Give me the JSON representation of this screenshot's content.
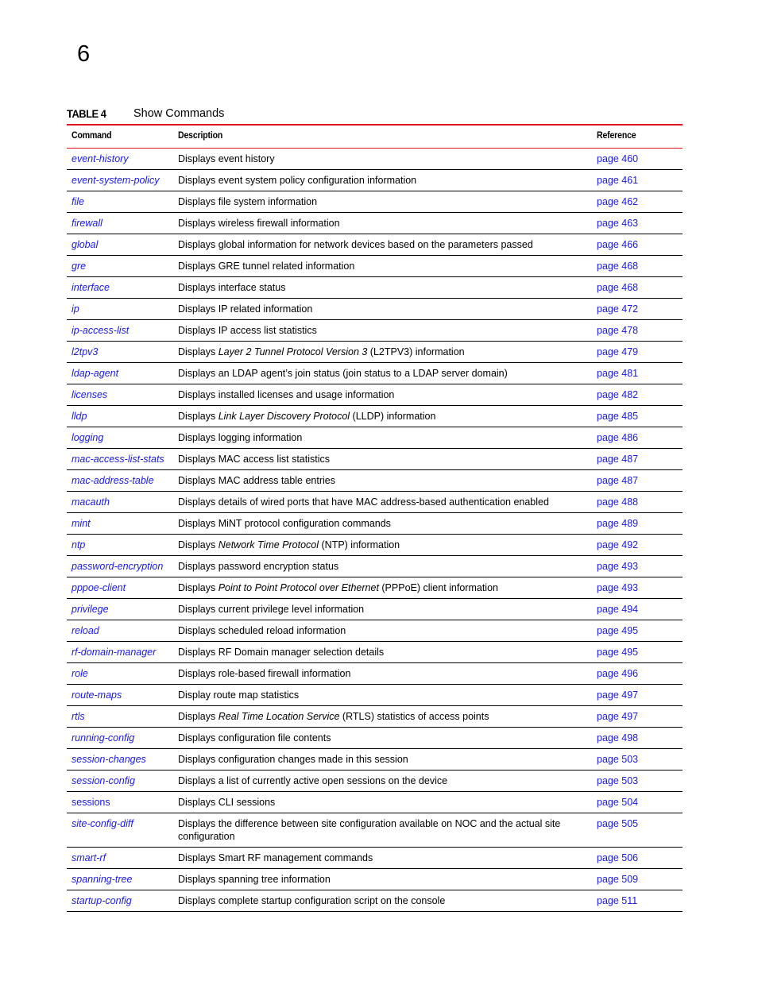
{
  "chapter_number": "6",
  "table": {
    "label": "TABLE 4",
    "title": "Show Commands",
    "headers": [
      "Command",
      "Description",
      "Reference"
    ],
    "rows": [
      {
        "command": "event-history",
        "desc": [
          {
            "t": "Displays event history"
          }
        ],
        "ref": "page 460"
      },
      {
        "command": "event-system-policy",
        "desc": [
          {
            "t": "Displays event system policy configuration information"
          }
        ],
        "ref": "page 461"
      },
      {
        "command": "file",
        "desc": [
          {
            "t": "Displays file system information"
          }
        ],
        "ref": "page 462"
      },
      {
        "command": "firewall",
        "desc": [
          {
            "t": "Displays wireless firewall information"
          }
        ],
        "ref": "page 463"
      },
      {
        "command": "global",
        "desc": [
          {
            "t": "Displays global information for network devices based on the parameters passed"
          }
        ],
        "ref": "page 466"
      },
      {
        "command": "gre",
        "desc": [
          {
            "t": "Displays GRE tunnel related information"
          }
        ],
        "ref": "page 468"
      },
      {
        "command": "interface",
        "desc": [
          {
            "t": "Displays interface status"
          }
        ],
        "ref": "page 468"
      },
      {
        "command": "ip",
        "desc": [
          {
            "t": "Displays IP related information"
          }
        ],
        "ref": "page 472"
      },
      {
        "command": "ip-access-list",
        "desc": [
          {
            "t": "Displays IP access list statistics"
          }
        ],
        "ref": "page 478"
      },
      {
        "command": "l2tpv3",
        "desc": [
          {
            "t": "Displays "
          },
          {
            "t": "Layer 2 Tunnel Protocol Version 3",
            "i": true
          },
          {
            "t": " (L2TPV3) information"
          }
        ],
        "ref": "page 479"
      },
      {
        "command": "ldap-agent",
        "desc": [
          {
            "t": "Displays an LDAP agent’s join status (join status to a LDAP server domain)"
          }
        ],
        "ref": "page 481"
      },
      {
        "command": "licenses",
        "desc": [
          {
            "t": "Displays installed licenses and usage information"
          }
        ],
        "ref": "page 482"
      },
      {
        "command": "lldp",
        "desc": [
          {
            "t": "Displays "
          },
          {
            "t": "Link Layer Discovery Protocol",
            "i": true
          },
          {
            "t": " (LLDP) information"
          }
        ],
        "ref": "page 485"
      },
      {
        "command": "logging",
        "desc": [
          {
            "t": "Displays logging information"
          }
        ],
        "ref": "page 486"
      },
      {
        "command": "mac-access-list-stats",
        "desc": [
          {
            "t": "Displays MAC access list statistics"
          }
        ],
        "ref": "page 487"
      },
      {
        "command": "mac-address-table",
        "desc": [
          {
            "t": "Displays MAC address table entries"
          }
        ],
        "ref": "page 487"
      },
      {
        "command": "macauth",
        "desc": [
          {
            "t": "Displays details of wired ports that have MAC address-based authentication enabled"
          }
        ],
        "ref": "page 488"
      },
      {
        "command": "mint",
        "desc": [
          {
            "t": "Displays MiNT protocol configuration commands"
          }
        ],
        "ref": "page 489"
      },
      {
        "command": "ntp",
        "desc": [
          {
            "t": "Displays "
          },
          {
            "t": "Network Time Protocol",
            "i": true
          },
          {
            "t": " (NTP) information"
          }
        ],
        "ref": "page 492"
      },
      {
        "command": "password-encryption",
        "desc": [
          {
            "t": "Displays password encryption status"
          }
        ],
        "ref": "page 493"
      },
      {
        "command": "pppoe-client",
        "desc": [
          {
            "t": "Displays "
          },
          {
            "t": "Point to Point Protocol over Ethernet",
            "i": true
          },
          {
            "t": " (PPPoE) client information"
          }
        ],
        "ref": "page 493"
      },
      {
        "command": "privilege",
        "desc": [
          {
            "t": "Displays current privilege level information"
          }
        ],
        "ref": "page 494"
      },
      {
        "command": "reload",
        "desc": [
          {
            "t": "Displays scheduled reload information"
          }
        ],
        "ref": "page 495"
      },
      {
        "command": "rf-domain-manager",
        "desc": [
          {
            "t": "Displays RF Domain manager selection details"
          }
        ],
        "ref": "page 495"
      },
      {
        "command": "role",
        "desc": [
          {
            "t": "Displays role-based firewall information"
          }
        ],
        "ref": "page 496"
      },
      {
        "command": "route-maps",
        "desc": [
          {
            "t": "Display route map statistics"
          }
        ],
        "ref": "page 497"
      },
      {
        "command": "rtls",
        "desc": [
          {
            "t": "Displays "
          },
          {
            "t": "Real Time Location Service",
            "i": true
          },
          {
            "t": " (RTLS) statistics of access points"
          }
        ],
        "ref": "page 497"
      },
      {
        "command": "running-config",
        "desc": [
          {
            "t": "Displays configuration file contents"
          }
        ],
        "ref": "page 498"
      },
      {
        "command": "session-changes",
        "desc": [
          {
            "t": "Displays configuration changes made in this session"
          }
        ],
        "ref": "page 503"
      },
      {
        "command": "session-config",
        "desc": [
          {
            "t": "Displays a list of currently active open sessions on the device"
          }
        ],
        "ref": "page 503"
      },
      {
        "command": "sessions",
        "upright": true,
        "desc": [
          {
            "t": "Displays CLI sessions"
          }
        ],
        "ref": "page 504"
      },
      {
        "command": "site-config-diff",
        "desc": [
          {
            "t": "Displays the difference between site configuration available on NOC and the actual site configuration"
          }
        ],
        "ref": "page 505"
      },
      {
        "command": "smart-rf",
        "desc": [
          {
            "t": "Displays Smart RF management commands"
          }
        ],
        "ref": "page 506"
      },
      {
        "command": "spanning-tree",
        "desc": [
          {
            "t": "Displays spanning tree information"
          }
        ],
        "ref": "page 509"
      },
      {
        "command": "startup-config",
        "desc": [
          {
            "t": "Displays complete startup configuration script on the console"
          }
        ],
        "ref": "page 511"
      }
    ]
  }
}
